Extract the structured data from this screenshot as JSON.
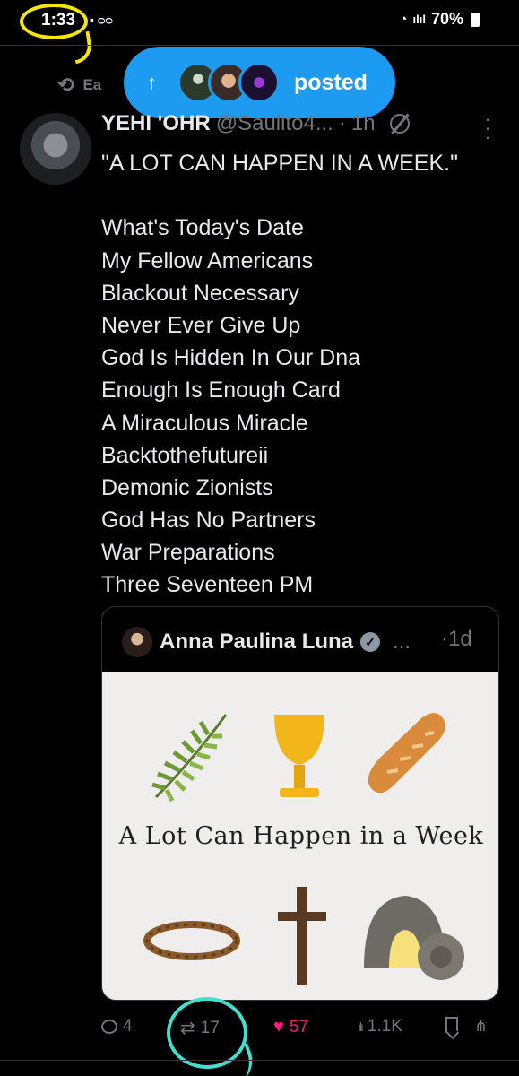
{
  "status_bar": {
    "time": "1:33",
    "battery": "70%",
    "icons": [
      "notification-icon",
      "voicemail-icon",
      "wifi-icon",
      "signal-icon",
      "battery-icon"
    ]
  },
  "repost_indicator": {
    "label": "Ea"
  },
  "new_posts_pill": {
    "arrow": "↑",
    "label": "posted"
  },
  "tweet": {
    "author_name": "YEHI 'OHR",
    "handle": "@Saulito4...",
    "dot": "·",
    "age": "1h",
    "lines": [
      "\"A LOT CAN HAPPEN IN A WEEK.\"",
      "",
      "What's Today's Date",
      "My Fellow Americans",
      "Blackout Necessary",
      "Never Ever Give Up",
      "God Is Hidden In Our Dna",
      "Enough Is Enough Card",
      "A Miraculous Miracle",
      "Backtothefutureii",
      "Demonic Zionists",
      "God Has No Partners",
      "War Preparations",
      "Three Seventeen PM"
    ]
  },
  "quote": {
    "author_name": "Anna Paulina Luna",
    "more": "...",
    "dot": "·",
    "age": "1d",
    "image_caption": "A Lot Can Happen in a Week"
  },
  "actions": {
    "replies": "4",
    "reposts": "17",
    "likes": "57",
    "views": "1.1K"
  },
  "colors": {
    "accent": "#1d9bf0",
    "like": "#f91880",
    "annotation_yellow": "#f5e50a",
    "annotation_cyan": "#3fe0cf"
  }
}
